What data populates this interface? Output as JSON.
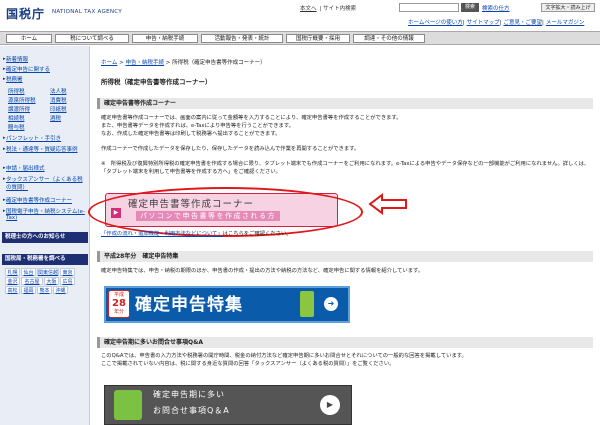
{
  "header": {
    "logo": "国税庁",
    "logo_en": "NATIONAL TAX AGENCY",
    "top_links": [
      "本文へ",
      "サイト内検索"
    ],
    "search_btn": "検索",
    "adv_search": "検索の仕方",
    "font_btn": "文字拡大・読み上げ",
    "sub_links": [
      "ホームページの使い方",
      "サイトマップ",
      "ご意見・ご要望",
      "メールマガジン"
    ]
  },
  "nav": [
    "ホーム",
    "税について調べる",
    "申告・納税手続",
    "活動報告・発表・統計",
    "国税庁概要・採用",
    "調達・その他の情報"
  ],
  "sidebar": {
    "items": [
      "新着情報",
      "確定申告に関する",
      "税務署",
      "タックスアンサー"
    ],
    "tax_items": [
      [
        "所得税",
        "法人税"
      ],
      [
        "源泉所得税",
        "消費税"
      ],
      [
        "譲渡所得",
        "印紙税"
      ],
      [
        "相続税",
        "酒税"
      ],
      [
        "贈与税",
        ""
      ]
    ],
    "links": [
      "パンフレット・手引き",
      "税法・通達等・質疑応答事例",
      "申請・届出様式",
      "タックスアンサー（よくある税の質問）",
      "確定申告書等作成コーナー",
      "国税電子申告・納税システム(e-Tax)"
    ],
    "head1": "税理士の方へのお知らせ",
    "head2": "国税局・税務署を調べる",
    "region_grid": [
      [
        "札幌",
        "仙台",
        "関東信越",
        "東京"
      ],
      [
        "金沢",
        "名古屋",
        "大阪",
        "広島"
      ],
      [
        "高松",
        "福岡",
        "熊本",
        "沖縄"
      ]
    ]
  },
  "breadcrumb": [
    "ホーム",
    "申告・納税手続",
    "所得税（確定申告書等作成コーナー）"
  ],
  "page_title": "所得税（確定申告書等作成コーナー）",
  "section1": {
    "heading": "確定申告書等作成コーナー",
    "p1": "確定申告書等作成コーナーでは、画面の案内に従って金額等を入力することにより、確定申告書等を作成することができます。",
    "p2": "また、申告書等データを作成すれば、e-Taxにより申告等を行うことができます。",
    "p3": "なお、作成した確定申告書等は印刷して税務署へ提出することができます。",
    "p4": "作成コーナーで作成したデータを保存したり、保存したデータを読み込んで作業を再開することができます。",
    "p5": "※　所得税及び復興特別所得税の確定申告書を作成する場合に限り、タブレット端末でも作成コーナーをご利用になれます。e-Taxによる申告やデータ保存などの一部機能がご利用になれません。詳しくは、「タブレット端末を利用して申告書等を作成する方へ」をご確認ください。",
    "link_note": "「作成の流れ・追加機能・利用方法などについて」",
    "link_note_tail": "はこちらをご確認ください。"
  },
  "banner1": {
    "title": "確定申告書等作成コーナー",
    "subtitle": "パソコンで申告書等を作成される方"
  },
  "section2": {
    "heading": "平成28年分　確定申告特集",
    "text": "確定申告特集では、申告・納税の期限のほか、申告書の作成・提出の方法や納税の方法など、確定申告に関する情報を紹介しています。"
  },
  "banner2": {
    "badge_top": "平成",
    "badge_year": "28",
    "badge_bottom": "年分",
    "title": "確定申告特集"
  },
  "section3": {
    "heading": "確定申告期に多いお問合せ事項Q&A",
    "text1": "このQ&Aでは、申告書の入力方法や税務署の開庁時間、税金の納付方法など確定申告期に多いお問合せとそれについての一般的な回答を掲載しています。",
    "text2": "ここで掲載されていない内容は、税に関する身近な質問の回答「タックスアンサー（よくある税の質問）」をご覧ください。"
  },
  "banner3": {
    "line1": "確定申告期に多い",
    "line2": "お問合せ事項Q＆A"
  },
  "colors": {
    "nav_bg": "#dcdcdc",
    "side_head": "#1f2f74",
    "highlight": "#e01818",
    "banner2_bg": "#0a5ba9"
  }
}
